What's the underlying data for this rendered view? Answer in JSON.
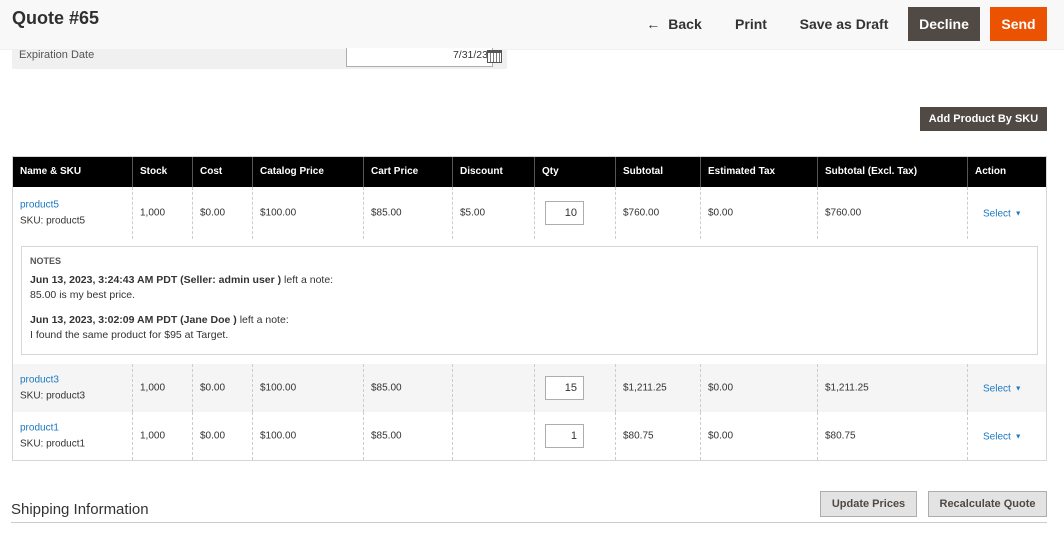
{
  "header": {
    "title": "Quote #65",
    "back_label": "Back",
    "print_label": "Print",
    "save_draft_label": "Save as Draft",
    "decline_label": "Decline",
    "send_label": "Send"
  },
  "expiration": {
    "label": "Expiration Date",
    "value": "7/31/23"
  },
  "add_by_sku_label": "Add Product By SKU",
  "table": {
    "columns": [
      "Name & SKU",
      "Stock",
      "Cost",
      "Catalog Price",
      "Cart Price",
      "Discount",
      "Qty",
      "Subtotal",
      "Estimated Tax",
      "Subtotal (Excl. Tax)",
      "Action"
    ],
    "rows": [
      {
        "name": "product5",
        "sku": "SKU: product5",
        "stock": "1,000",
        "cost": "$0.00",
        "catalog_price": "$100.00",
        "cart_price": "$85.00",
        "discount": "$5.00",
        "qty": "10",
        "subtotal": "$760.00",
        "tax": "$0.00",
        "subtotal_excl": "$760.00",
        "action": "Select"
      },
      {
        "name": "product3",
        "sku": "SKU: product3",
        "stock": "1,000",
        "cost": "$0.00",
        "catalog_price": "$100.00",
        "cart_price": "$85.00",
        "discount": "",
        "qty": "15",
        "subtotal": "$1,211.25",
        "tax": "$0.00",
        "subtotal_excl": "$1,211.25",
        "action": "Select"
      },
      {
        "name": "product1",
        "sku": "SKU: product1",
        "stock": "1,000",
        "cost": "$0.00",
        "catalog_price": "$100.00",
        "cart_price": "$85.00",
        "discount": "",
        "qty": "1",
        "subtotal": "$80.75",
        "tax": "$0.00",
        "subtotal_excl": "$80.75",
        "action": "Select"
      }
    ]
  },
  "notes": {
    "title": "NOTES",
    "items": [
      {
        "meta": "Jun 13, 2023, 3:24:43 AM PDT (Seller: admin user )",
        "suffix": " left a note:",
        "text": "85.00 is my best price."
      },
      {
        "meta": "Jun 13, 2023, 3:02:09 AM PDT (Jane Doe )",
        "suffix": " left a note:",
        "text": "I found the same product for $95 at Target."
      }
    ]
  },
  "shipping_title": "Shipping Information",
  "update_prices_label": "Update Prices",
  "recalculate_label": "Recalculate Quote"
}
